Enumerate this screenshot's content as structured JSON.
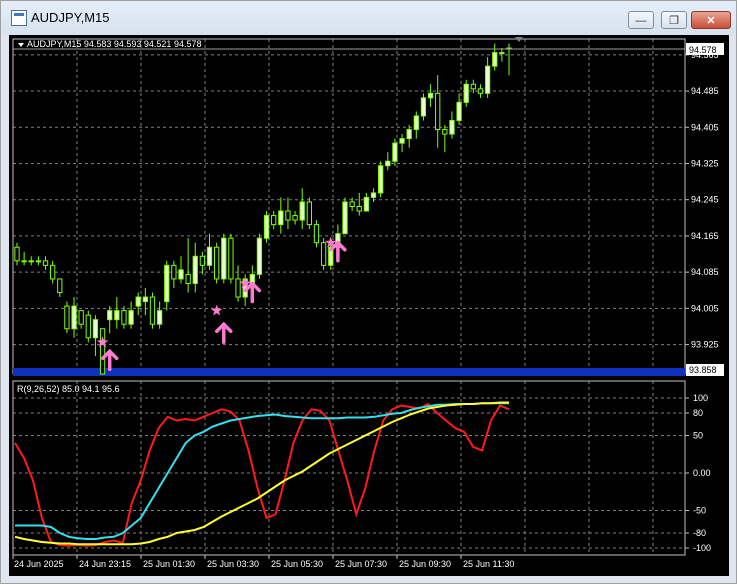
{
  "window": {
    "title": "AUDJPY,M15",
    "minimize_glyph": "—",
    "restore_glyph": "❐",
    "close_glyph": "✕"
  },
  "chart_info": "AUDJPY,M15  94.583 94.593 94.521 94.578",
  "indicator_label": "R(9,26,52) 85.0 94.1 95.6",
  "colors": {
    "background": "#000000",
    "grid": "#808080",
    "bull_candle": "#e6ffcc",
    "wick": "#7fff00",
    "bear_candle": "#000000",
    "stoch_red": "#ff1a1a",
    "stoch_cyan": "#33e0f0",
    "stoch_yellow": "#ffff33",
    "arrow": "#ff7ad0",
    "blue_band": "#1030c0"
  },
  "chart_data": [
    {
      "type": "candlestick",
      "symbol": "AUDJPY",
      "timeframe": "M15",
      "current_price": "94.578",
      "price_line_label": "93.858",
      "ylim": [
        93.86,
        94.6
      ],
      "y_ticks": [
        "94.565",
        "94.485",
        "94.405",
        "94.325",
        "94.245",
        "94.165",
        "94.085",
        "94.005",
        "93.925"
      ],
      "x_tick_labels": [
        "24 Jun 2025",
        "24 Jun 23:15",
        "25 Jun 01:30",
        "25 Jun 03:30",
        "25 Jun 05:30",
        "25 Jun 07:30",
        "25 Jun 09:30",
        "25 Jun 11:30"
      ],
      "candles": [
        [
          94.14,
          94.15,
          94.1,
          94.11
        ],
        [
          94.11,
          94.13,
          94.1,
          94.11
        ],
        [
          94.11,
          94.12,
          94.1,
          94.11
        ],
        [
          94.11,
          94.12,
          94.1,
          94.11
        ],
        [
          94.11,
          94.12,
          94.09,
          94.1
        ],
        [
          94.1,
          94.11,
          94.06,
          94.07
        ],
        [
          94.07,
          94.07,
          94.03,
          94.04
        ],
        [
          94.01,
          94.02,
          93.95,
          93.96
        ],
        [
          93.96,
          94.03,
          93.94,
          94.01
        ],
        [
          94.0,
          94.0,
          93.96,
          93.97
        ],
        [
          93.99,
          94.0,
          93.93,
          93.94
        ],
        [
          93.94,
          93.99,
          93.9,
          93.98
        ],
        [
          93.96,
          93.96,
          93.86,
          93.86
        ],
        [
          93.98,
          94.01,
          93.95,
          94.0
        ],
        [
          93.98,
          94.03,
          93.96,
          94.0
        ],
        [
          94.0,
          94.01,
          93.96,
          93.97
        ],
        [
          93.97,
          94.02,
          93.96,
          94.0
        ],
        [
          94.01,
          94.04,
          93.99,
          94.03
        ],
        [
          94.02,
          94.05,
          93.99,
          94.03
        ],
        [
          94.03,
          94.04,
          93.96,
          93.97
        ],
        [
          93.97,
          94.02,
          93.96,
          94.0
        ],
        [
          94.02,
          94.11,
          94.0,
          94.1
        ],
        [
          94.1,
          94.11,
          94.05,
          94.07
        ],
        [
          94.07,
          94.12,
          94.06,
          94.09
        ],
        [
          94.08,
          94.16,
          94.04,
          94.06
        ],
        [
          94.06,
          94.15,
          94.04,
          94.12
        ],
        [
          94.12,
          94.13,
          94.08,
          94.1
        ],
        [
          94.1,
          94.17,
          94.09,
          94.14
        ],
        [
          94.14,
          94.15,
          94.06,
          94.07
        ],
        [
          94.07,
          94.17,
          94.06,
          94.16
        ],
        [
          94.16,
          94.17,
          94.06,
          94.07
        ],
        [
          94.07,
          94.1,
          94.02,
          94.03
        ],
        [
          94.03,
          94.08,
          94.01,
          94.07
        ],
        [
          94.06,
          94.1,
          94.06,
          94.08
        ],
        [
          94.08,
          94.17,
          94.07,
          94.16
        ],
        [
          94.16,
          94.22,
          94.15,
          94.21
        ],
        [
          94.21,
          94.22,
          94.18,
          94.19
        ],
        [
          94.19,
          94.25,
          94.17,
          94.22
        ],
        [
          94.22,
          94.25,
          94.18,
          94.2
        ],
        [
          94.21,
          94.22,
          94.19,
          94.2
        ],
        [
          94.2,
          94.27,
          94.18,
          94.24
        ],
        [
          94.24,
          94.25,
          94.18,
          94.19
        ],
        [
          94.19,
          94.2,
          94.14,
          94.15
        ],
        [
          94.15,
          94.16,
          94.09,
          94.1
        ],
        [
          94.1,
          94.15,
          94.09,
          94.14
        ],
        [
          94.14,
          94.19,
          94.13,
          94.17
        ],
        [
          94.17,
          94.25,
          94.17,
          94.24
        ],
        [
          94.24,
          94.25,
          94.22,
          94.23
        ],
        [
          94.23,
          94.26,
          94.21,
          94.22
        ],
        [
          94.22,
          94.26,
          94.22,
          94.25
        ],
        [
          94.25,
          94.27,
          94.24,
          94.26
        ],
        [
          94.26,
          94.33,
          94.25,
          94.32
        ],
        [
          94.32,
          94.35,
          94.31,
          94.33
        ],
        [
          94.33,
          94.38,
          94.32,
          94.37
        ],
        [
          94.37,
          94.39,
          94.35,
          94.38
        ],
        [
          94.38,
          94.41,
          94.36,
          94.4
        ],
        [
          94.4,
          94.44,
          94.38,
          94.43
        ],
        [
          94.43,
          94.48,
          94.42,
          94.47
        ],
        [
          94.47,
          94.5,
          94.45,
          94.48
        ],
        [
          94.48,
          94.52,
          94.36,
          94.4
        ],
        [
          94.4,
          94.41,
          94.35,
          94.39
        ],
        [
          94.39,
          94.44,
          94.38,
          94.42
        ],
        [
          94.42,
          94.48,
          94.41,
          94.46
        ],
        [
          94.46,
          94.51,
          94.45,
          94.5
        ],
        [
          94.5,
          94.51,
          94.48,
          94.49
        ],
        [
          94.49,
          94.5,
          94.47,
          94.48
        ],
        [
          94.48,
          94.56,
          94.47,
          94.54
        ],
        [
          94.54,
          94.59,
          94.53,
          94.57
        ],
        [
          94.57,
          94.58,
          94.55,
          94.57
        ],
        [
          94.58,
          94.59,
          94.52,
          94.58
        ]
      ],
      "signals": [
        {
          "bar": 12,
          "price": 93.93,
          "kind": "star"
        },
        {
          "bar": 13,
          "price": 93.91,
          "kind": "arrow"
        },
        {
          "bar": 28,
          "price": 94.0,
          "kind": "star"
        },
        {
          "bar": 29,
          "price": 93.97,
          "kind": "arrow"
        },
        {
          "bar": 32,
          "price": 94.06,
          "kind": "star"
        },
        {
          "bar": 33,
          "price": 94.06,
          "kind": "arrow"
        },
        {
          "bar": 44,
          "price": 94.15,
          "kind": "star"
        },
        {
          "bar": 45,
          "price": 94.15,
          "kind": "arrow"
        }
      ]
    },
    {
      "type": "line",
      "name": "R(9,26,52)",
      "ylim": [
        -100,
        100
      ],
      "y_ticks": [
        "100",
        "80",
        "50",
        "0.00",
        "-50",
        "-80",
        "-100"
      ],
      "series": [
        {
          "color": "#ff1a1a",
          "values": [
            40,
            20,
            -10,
            -60,
            -92,
            -96,
            -97,
            -96,
            -97,
            -96,
            -92,
            -90,
            -93,
            -40,
            -10,
            30,
            60,
            75,
            70,
            72,
            70,
            75,
            80,
            85,
            82,
            70,
            30,
            -20,
            -60,
            -55,
            -10,
            40,
            70,
            85,
            83,
            70,
            30,
            -10,
            -55,
            -20,
            30,
            70,
            85,
            90,
            88,
            86,
            92,
            80,
            70,
            60,
            55,
            35,
            30,
            70,
            90,
            85
          ]
        },
        {
          "color": "#33e0f0",
          "values": [
            -70,
            -70,
            -70,
            -70,
            -72,
            -80,
            -85,
            -87,
            -88,
            -88,
            -86,
            -85,
            -80,
            -70,
            -60,
            -40,
            -20,
            0,
            20,
            40,
            50,
            55,
            62,
            66,
            70,
            72,
            74,
            76,
            77,
            78,
            76,
            75,
            74,
            73,
            73,
            73,
            73,
            74,
            74,
            74,
            75,
            77,
            79,
            80,
            84,
            87,
            89,
            91,
            91,
            92,
            92,
            92,
            93,
            93,
            93,
            93
          ]
        },
        {
          "color": "#ffff33",
          "values": [
            -85,
            -88,
            -90,
            -92,
            -93,
            -94,
            -94,
            -95,
            -95,
            -95,
            -95,
            -95,
            -95,
            -95,
            -94,
            -92,
            -88,
            -85,
            -80,
            -78,
            -76,
            -72,
            -65,
            -58,
            -52,
            -46,
            -40,
            -34,
            -26,
            -18,
            -10,
            -4,
            2,
            10,
            18,
            26,
            32,
            38,
            44,
            50,
            56,
            62,
            68,
            73,
            78,
            82,
            86,
            88,
            90,
            91,
            92,
            92,
            93,
            93,
            94,
            94
          ]
        }
      ]
    }
  ]
}
